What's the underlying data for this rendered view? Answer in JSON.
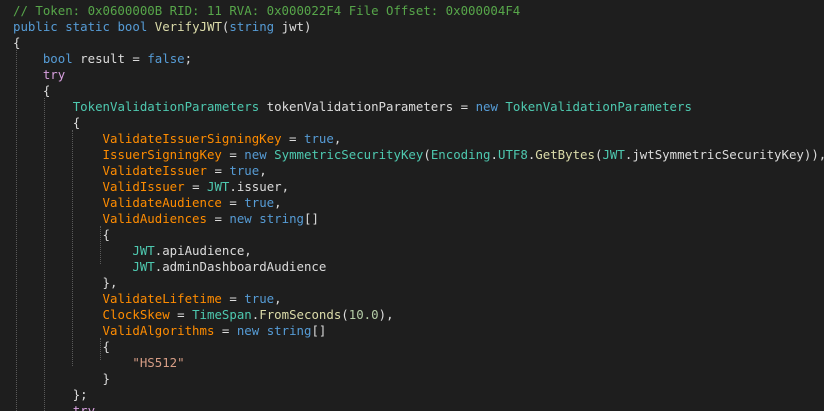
{
  "comment": "// Token: 0x0600000B RID: 11 RVA: 0x000022F4 File Offset: 0x000004F4",
  "signature": {
    "modifiers": "public static",
    "return_type": "bool",
    "method_name": "VerifyJWT",
    "param_type": "string",
    "param_name": "jwt"
  },
  "body": {
    "result_decl": {
      "type": "bool",
      "name": "result",
      "value": "false"
    },
    "try_kw": "try",
    "tvp_decl": {
      "type": "TokenValidationParameters",
      "name": "tokenValidationParameters",
      "new_kw": "new",
      "new_type": "TokenValidationParameters"
    },
    "props": {
      "validate_issuer_signing_key": {
        "name": "ValidateIssuerSigningKey",
        "value": "true"
      },
      "issuer_signing_key": {
        "name": "IssuerSigningKey",
        "new_kw": "new",
        "type": "SymmetricSecurityKey",
        "encoding": "Encoding",
        "utf8": "UTF8",
        "method": "GetBytes",
        "jwt_class": "JWT",
        "member": "jwtSymmetricSecurityKey"
      },
      "validate_issuer": {
        "name": "ValidateIssuer",
        "value": "true"
      },
      "valid_issuer": {
        "name": "ValidIssuer",
        "class": "JWT",
        "member": "issuer"
      },
      "validate_audience": {
        "name": "ValidateAudience",
        "value": "true"
      },
      "valid_audiences": {
        "name": "ValidAudiences",
        "new_kw": "new",
        "type": "string",
        "items": [
          {
            "class": "JWT",
            "member": "apiAudience"
          },
          {
            "class": "JWT",
            "member": "adminDashboardAudience"
          }
        ]
      },
      "validate_lifetime": {
        "name": "ValidateLifetime",
        "value": "true"
      },
      "clock_skew": {
        "name": "ClockSkew",
        "type": "TimeSpan",
        "method": "FromSeconds",
        "arg": "10.0"
      },
      "valid_algorithms": {
        "name": "ValidAlgorithms",
        "new_kw": "new",
        "type": "string",
        "item": "\"HS512\""
      }
    },
    "inner_try_kw": "try"
  }
}
